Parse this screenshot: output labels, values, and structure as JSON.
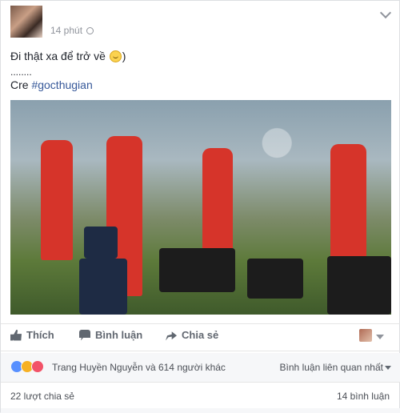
{
  "post": {
    "time": "14 phút",
    "line1": "Đi thật xa để trở về",
    "line1_suffix": ")",
    "dots": "........",
    "credit_prefix": "Cre",
    "hashtag": "#gocthugian"
  },
  "actions": {
    "like": "Thích",
    "comment": "Bình luận",
    "share": "Chia sẻ"
  },
  "reactions": {
    "summary": "Trang Huyền Nguyễn và 614 người khác",
    "sort": "Bình luận liên quan nhất"
  },
  "stats": {
    "shares": "22 lượt chia sẻ",
    "comments": "14 bình luận"
  },
  "colors": {
    "link": "#365899",
    "like_blue": "#5890ff",
    "haha_yellow": "#f7b125",
    "love_red": "#f25268"
  }
}
